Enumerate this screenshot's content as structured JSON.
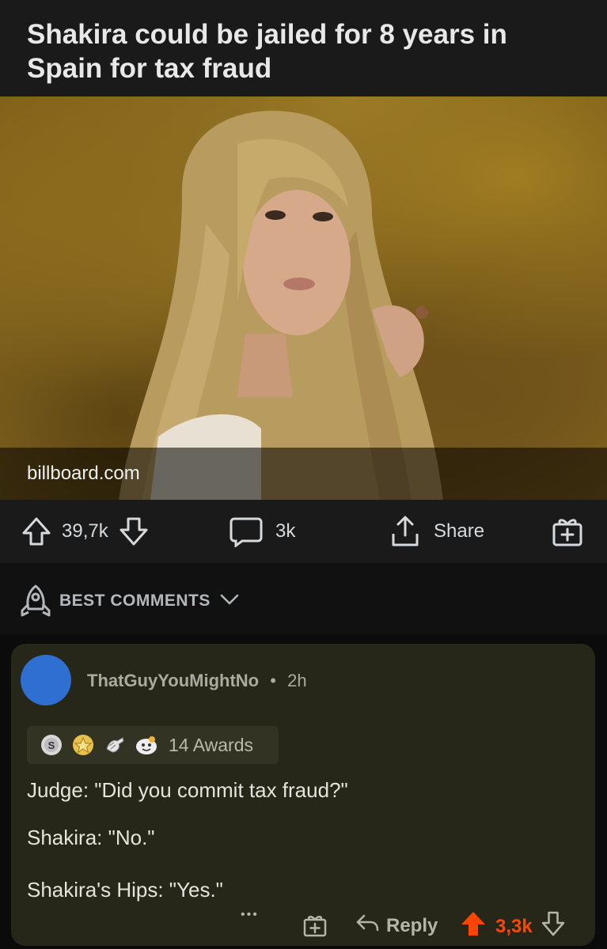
{
  "post": {
    "title": "Shakira could be jailed for 8 years in Spain for tax fraud",
    "link": "billboard.com",
    "upvotes": "39,7k",
    "comments": "3k",
    "share_label": "Share"
  },
  "sort": {
    "label": "BEST COMMENTS"
  },
  "comment": {
    "author": "ThatGuyYouMightNo",
    "separator": "•",
    "time": "2h",
    "awards": "14 Awards",
    "lines": [
      "Judge: \"Did you commit tax fraud?\"",
      "Shakira: \"No.\"",
      "Shakira's Hips: \"Yes.\""
    ],
    "more": "•••",
    "reply_label": "Reply",
    "score": "3,3k"
  },
  "colors": {
    "background": "#0b0b0b",
    "card": "#1a1a1b",
    "comment_bg": "#272719",
    "avatar": "#2e6fd1",
    "upvote_active": "#ff4500"
  },
  "icons": [
    "upvote-icon",
    "downvote-icon",
    "comment-icon",
    "share-icon",
    "award-gift-icon",
    "rocket-icon",
    "chevron-down-icon",
    "silver-award-icon",
    "gold-award-icon",
    "helpful-award-icon",
    "wholesome-award-icon",
    "more-icon",
    "reply-icon"
  ]
}
